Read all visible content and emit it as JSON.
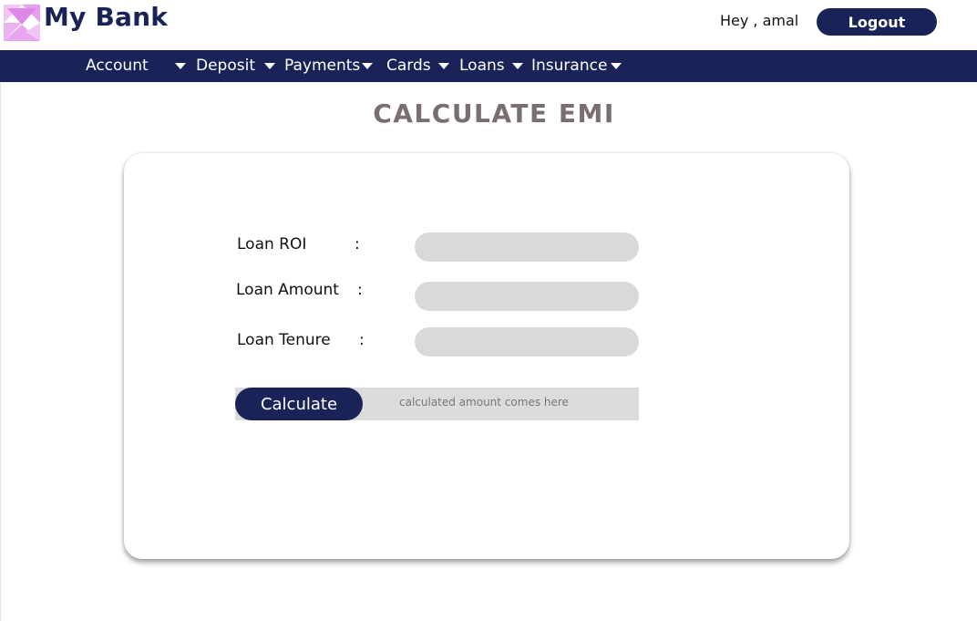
{
  "header": {
    "brand": "My Bank",
    "greeting": "Hey , amal",
    "logout_label": "Logout"
  },
  "nav": {
    "items": [
      {
        "label": "Account"
      },
      {
        "label": "Deposit"
      },
      {
        "label": "Payments"
      },
      {
        "label": "Cards"
      },
      {
        "label": "Loans"
      },
      {
        "label": "Insurance"
      }
    ]
  },
  "page": {
    "title": "CALCULATE EMI"
  },
  "form": {
    "roi_label": "Loan ROI",
    "amount_label": "Loan Amount",
    "tenure_label": "Loan Tenure",
    "separator": ":",
    "roi_value": "",
    "amount_value": "",
    "tenure_value": "",
    "calculate_label": "Calculate",
    "result_text": "calculated amount comes here"
  },
  "colors": {
    "brand": "#1a2357",
    "title": "#7a6e6e",
    "field_bg": "#d9d9d9",
    "logo_pink": "#e8a6f0"
  }
}
